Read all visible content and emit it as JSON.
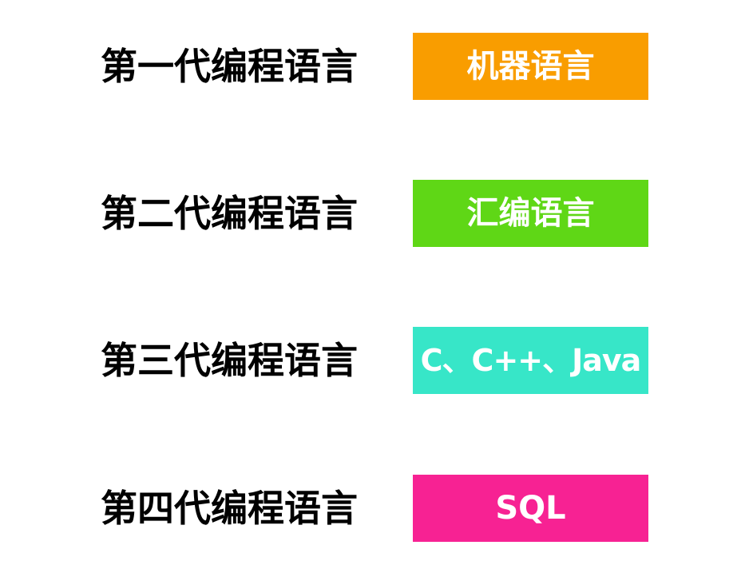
{
  "rows": [
    {
      "generation": "第一代编程语言",
      "language": "机器语言",
      "color": "#F99D00"
    },
    {
      "generation": "第二代编程语言",
      "language": "汇编语言",
      "color": "#5FD716"
    },
    {
      "generation": "第三代编程语言",
      "language": "C、C++、Java",
      "color": "#37E6C8"
    },
    {
      "generation": "第四代编程语言",
      "language": "SQL",
      "color": "#F72293"
    }
  ]
}
